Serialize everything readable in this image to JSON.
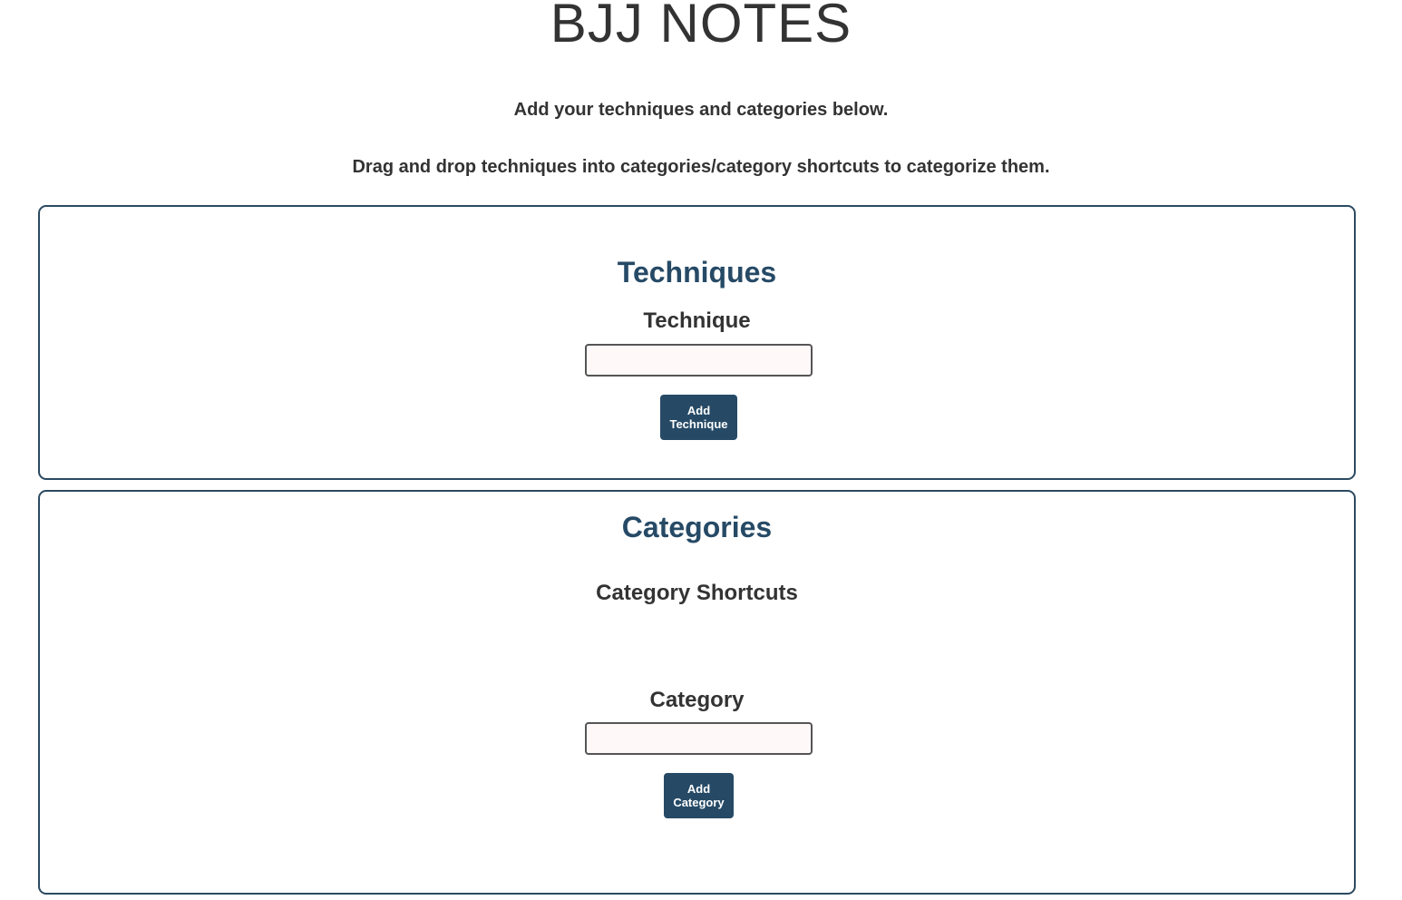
{
  "app": {
    "title": "BJJ NOTES"
  },
  "intro": {
    "line1": "Add your techniques and categories below.",
    "line2": "Drag and drop techniques into categories/category shortcuts to categorize them."
  },
  "techniques": {
    "heading": "Techniques",
    "field_label": "Technique",
    "input_value": "",
    "input_placeholder": "",
    "button_line1": "Add",
    "button_line2": "Technique"
  },
  "categories": {
    "heading": "Categories",
    "shortcuts_heading": "Category Shortcuts",
    "field_label": "Category",
    "input_value": "",
    "input_placeholder": "",
    "button_line1": "Add",
    "button_line2": "Category"
  },
  "colors": {
    "accent": "#264a66",
    "panel_border": "#2b4a61",
    "text": "#333333",
    "input_background": "#fff8f8"
  }
}
